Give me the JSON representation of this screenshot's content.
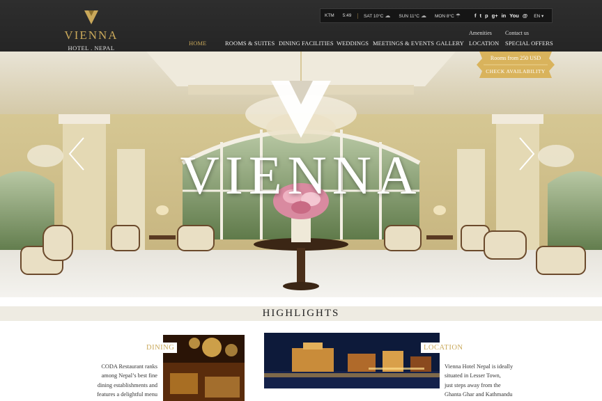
{
  "brand": {
    "name": "VIENNA",
    "subtitle": "HOTEL . NEPAL",
    "gold": "#c9a85a"
  },
  "topbar": {
    "city": "KTM",
    "time": "5:49",
    "separator": "|",
    "forecast": [
      {
        "day": "SAT 10°C",
        "icon": "cloud-icon"
      },
      {
        "day": "SUN 11°C",
        "icon": "cloud-icon"
      },
      {
        "day": "MON 8°C",
        "icon": "rain-icon"
      }
    ],
    "social": [
      "f",
      "t",
      "p",
      "g+",
      "in",
      "You",
      "@"
    ],
    "language": "EN ▾"
  },
  "nav": {
    "items": [
      "HOME",
      "ROOMS & SUITES",
      "DINING FACILITIES",
      "WEDDINGS",
      "MEETINGS & EVENTS",
      "GALLERY",
      "LOCATION",
      "SPECIAL OFFERS"
    ],
    "top_links": [
      "Amenities",
      "Contact us"
    ],
    "active": "HOME"
  },
  "hero": {
    "title": "VIENNA",
    "offer": {
      "line1": "Rooms from 250 USD",
      "line2": "CHECK AVAILABILITY"
    }
  },
  "highlights": {
    "title": "HIGHLIGHTS",
    "dining": {
      "label": "DINING",
      "lines": [
        "CODA Restaurant ranks",
        "among Nepal’s best fine",
        "dining establishments and",
        "features a delightful menu"
      ]
    },
    "location": {
      "label": "LOCATION",
      "lines": [
        "Vienna Hotel Nepal is ideally",
        "situated in Lesser Town,",
        "just steps away from the",
        "Ghanta Ghar and Kathmandu"
      ]
    }
  }
}
